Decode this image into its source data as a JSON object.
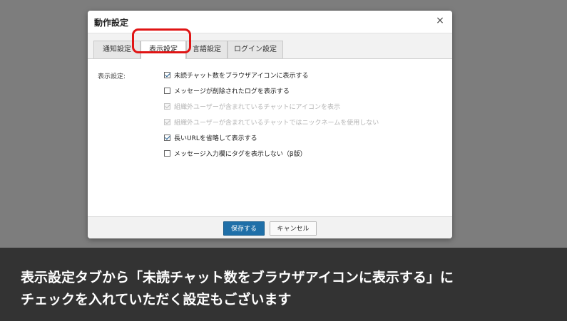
{
  "dialog": {
    "title": "動作設定",
    "close_icon": "close-icon"
  },
  "tabs": [
    {
      "label": "通知設定",
      "active": false
    },
    {
      "label": "表示設定",
      "active": true
    },
    {
      "label": "言語設定",
      "active": false
    },
    {
      "label": "ログイン設定",
      "active": false
    }
  ],
  "section_label": "表示設定:",
  "options": [
    {
      "label": "未読チャット数をブラウザアイコンに表示する",
      "checked": true,
      "disabled": false
    },
    {
      "label": "メッセージが削除されたログを表示する",
      "checked": false,
      "disabled": false
    },
    {
      "label": "組織外ユーザーが含まれているチャットにアイコンを表示",
      "checked": true,
      "disabled": true
    },
    {
      "label": "組織外ユーザーが含まれているチャットではニックネームを使用しない",
      "checked": true,
      "disabled": true
    },
    {
      "label": "長いURLを省略して表示する",
      "checked": true,
      "disabled": false
    },
    {
      "label": "メッセージ入力欄にタグを表示しない（β版）",
      "checked": false,
      "disabled": false
    }
  ],
  "footer": {
    "save_label": "保存する",
    "cancel_label": "キャンセル"
  },
  "caption": {
    "line1": "表示設定タブから「未読チャット数をブラウザアイコンに表示する」に",
    "line2": "チェックを入れていただく設定もございます"
  },
  "colors": {
    "highlight": "#e01414",
    "primary_button": "#1f6fa8",
    "caption_background": "#333333"
  }
}
